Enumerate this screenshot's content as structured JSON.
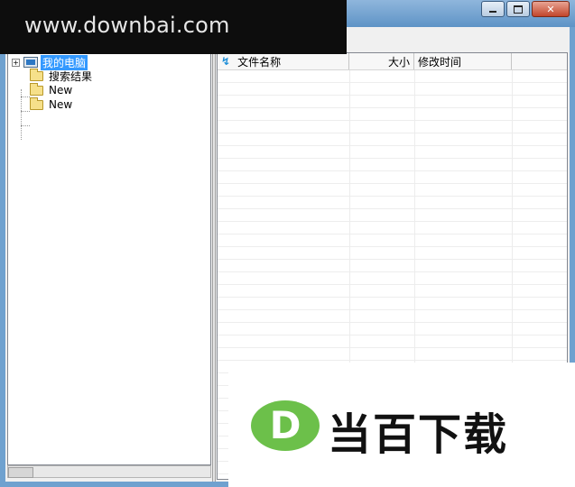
{
  "window": {
    "minimize_glyph": "–",
    "close_glyph": "✕"
  },
  "tree": {
    "root": {
      "label": "我的电脑",
      "icon": "computer-icon",
      "expand_glyph": "+"
    },
    "items": [
      {
        "label": "搜索结果",
        "icon": "folder-icon"
      },
      {
        "label": "New",
        "icon": "folder-icon"
      },
      {
        "label": "New",
        "icon": "folder-icon"
      }
    ]
  },
  "list": {
    "sort_icon": "↯",
    "columns": {
      "name": "文件名称",
      "size": "大小",
      "modified": "修改时间"
    }
  },
  "watermark": {
    "site": "www.downbai.com",
    "logo_letter": "D",
    "brand": "当百下载",
    "colors": {
      "logo_green": "#6cc04a"
    }
  }
}
